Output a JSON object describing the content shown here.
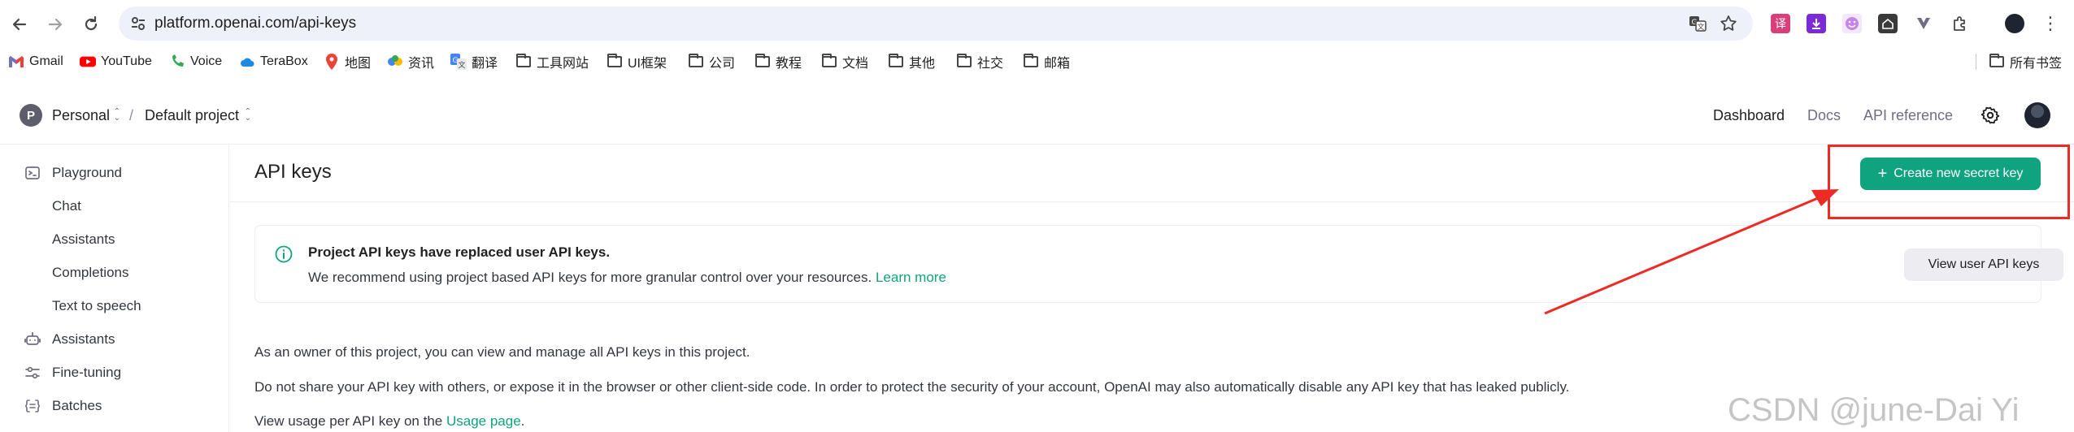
{
  "browser": {
    "url": "platform.openai.com/api-keys"
  },
  "bookmarks": {
    "items": [
      {
        "label": "Gmail",
        "icon": "gmail-icon"
      },
      {
        "label": "YouTube",
        "icon": "youtube-icon"
      },
      {
        "label": "Voice",
        "icon": "voice-icon"
      },
      {
        "label": "TeraBox",
        "icon": "terabox-icon"
      },
      {
        "label": "地图",
        "icon": "maps-icon"
      },
      {
        "label": "资讯",
        "icon": "news-icon"
      },
      {
        "label": "翻译",
        "icon": "translate-icon"
      },
      {
        "label": "工具网站",
        "icon": "folder-icon"
      },
      {
        "label": "UI框架",
        "icon": "folder-icon"
      },
      {
        "label": "公司",
        "icon": "folder-icon"
      },
      {
        "label": "教程",
        "icon": "folder-icon"
      },
      {
        "label": "文档",
        "icon": "folder-icon"
      },
      {
        "label": "其他",
        "icon": "folder-icon"
      },
      {
        "label": "社交",
        "icon": "folder-icon"
      },
      {
        "label": "邮箱",
        "icon": "folder-icon"
      }
    ],
    "all_bookmarks": "所有书签"
  },
  "header": {
    "org_initial": "P",
    "org_name": "Personal",
    "separator": "/",
    "project_name": "Default project",
    "nav": {
      "dashboard": "Dashboard",
      "docs": "Docs",
      "api_reference": "API reference"
    }
  },
  "sidebar": {
    "items": [
      {
        "label": "Playground",
        "icon": "playground-icon"
      },
      {
        "label": "Chat"
      },
      {
        "label": "Assistants"
      },
      {
        "label": "Completions"
      },
      {
        "label": "Text to speech"
      },
      {
        "label": "Assistants",
        "icon": "assistants-icon"
      },
      {
        "label": "Fine-tuning",
        "icon": "fine-tuning-icon"
      },
      {
        "label": "Batches",
        "icon": "batches-icon"
      }
    ]
  },
  "main": {
    "title": "API keys",
    "create_button": "Create new secret key",
    "notice": {
      "title": "Project API keys have replaced user API keys.",
      "body": "We recommend using project based API keys for more granular control over your resources.",
      "learn_more": "Learn more",
      "view_user_keys": "View user API keys"
    },
    "para1": "As an owner of this project, you can view and manage all API keys in this project.",
    "para2": "Do not share your API key with others, or expose it in the browser or other client-side code. In order to protect the security of your account, OpenAI may also automatically disable any API key that has leaked publicly.",
    "para3_prefix": "View usage per API key on the",
    "para3_link": "Usage page",
    "para3_suffix": "."
  },
  "watermark": "CSDN @june-Dai Yi",
  "colors": {
    "accent": "#10a37f",
    "annotation": "#ee2a24"
  }
}
